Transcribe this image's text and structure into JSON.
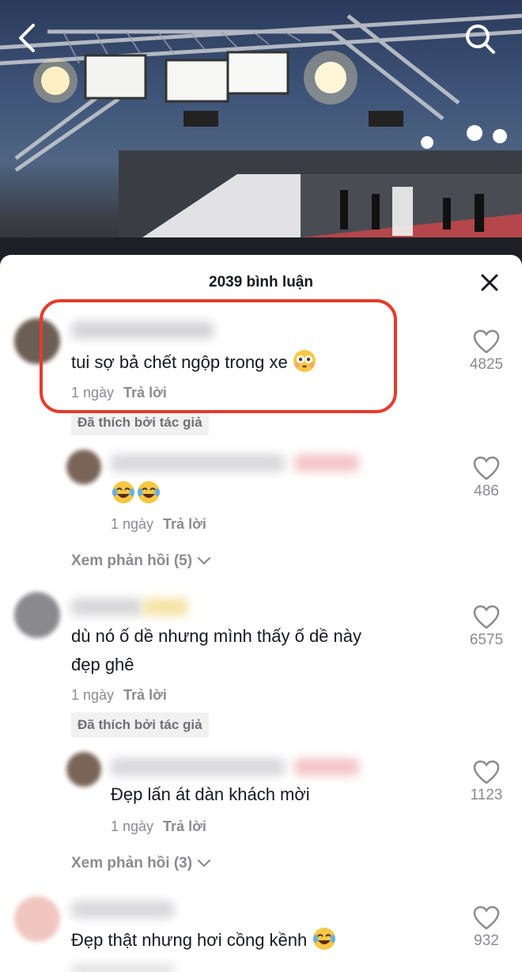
{
  "video": {
    "back_icon": "chevron-left-icon",
    "search_icon": "search-icon"
  },
  "sheet": {
    "title": "2039 bình luận",
    "close_icon": "close-icon"
  },
  "comments": [
    {
      "text": "tui sợ bả chết ngộp trong xe",
      "emoji": "flushed-face",
      "time": "1 ngày",
      "reply_label": "Trả lời",
      "liked_by_author": "Đã thích bởi tác giả",
      "likes": "4825",
      "highlighted": true,
      "reply": {
        "emoji": "tears-of-joy x2",
        "time": "1 ngày",
        "reply_label": "Trả lời",
        "likes": "486"
      },
      "view_replies": "Xem phản hồi (5)"
    },
    {
      "text_line1": "dù nó ố dề nhưng mình thấy ố dề này",
      "text_line2": "đẹp ghê",
      "time": "1 ngày",
      "reply_label": "Trả lời",
      "liked_by_author": "Đã thích bởi tác giả",
      "likes": "6575",
      "reply": {
        "text": "Đẹp lấn át dàn khách mời",
        "time": "1 ngày",
        "reply_label": "Trả lời",
        "likes": "1123"
      },
      "view_replies": "Xem phản hồi (3)"
    },
    {
      "text": "Đẹp thật nhưng hơi cồng kềnh",
      "emoji": "tears-of-joy",
      "likes": "932"
    }
  ],
  "colors": {
    "highlight": "#e53b2c",
    "text_primary": "#161823",
    "text_secondary": "#8a8b91"
  }
}
